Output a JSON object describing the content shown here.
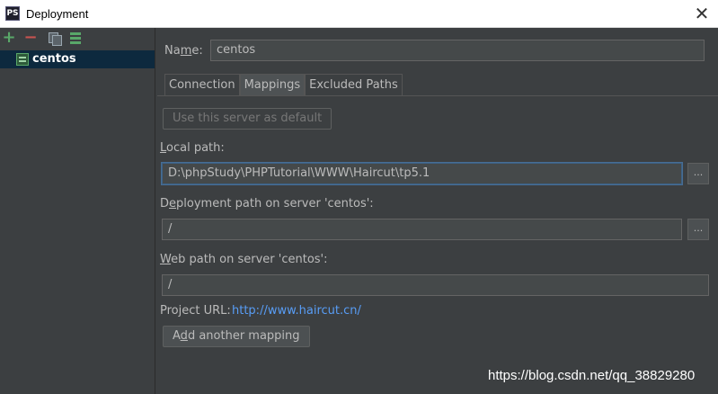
{
  "window": {
    "title": "Deployment",
    "logo_text": "PS",
    "close_glyph": "✕"
  },
  "toolbar": {
    "add_glyph": "+",
    "remove_glyph": "−"
  },
  "tree": {
    "items": [
      {
        "label": "centos"
      }
    ]
  },
  "form": {
    "name_label_pre": "Na",
    "name_label_u": "m",
    "name_label_post": "e:",
    "name_value": "centos"
  },
  "tabs": [
    {
      "label": "Connection"
    },
    {
      "label": "Mappings"
    },
    {
      "label": "Excluded Paths"
    }
  ],
  "mappings": {
    "use_default_button": "Use this server as default",
    "local_path_label_u": "L",
    "local_path_label_post": "ocal path:",
    "local_path_value": "D:\\phpStudy\\PHPTutorial\\WWW\\Haircut\\tp5.1",
    "browse_glyph": "...",
    "deployment_path_label_pre": "D",
    "deployment_path_label_u": "e",
    "deployment_path_label_post": "ployment path on server 'centos':",
    "deployment_path_value": "/",
    "web_path_label_u": "W",
    "web_path_label_post": "eb path on server 'centos':",
    "web_path_value": "/",
    "project_url_label": "Project URL:",
    "project_url_value": "http://www.haircut.cn/",
    "add_mapping_pre": "A",
    "add_mapping_u": "d",
    "add_mapping_post": "d another mapping"
  },
  "watermark": "https://blog.csdn.net/qq_38829280",
  "colors": {
    "background": "#3c3f41",
    "selection": "#0d293e",
    "link": "#589df6",
    "focus_border": "#3d6185"
  },
  "icons": [
    "ps-logo-icon",
    "close-icon",
    "add-icon",
    "remove-icon",
    "copy-icon",
    "set-default-icon",
    "server-icon"
  ]
}
